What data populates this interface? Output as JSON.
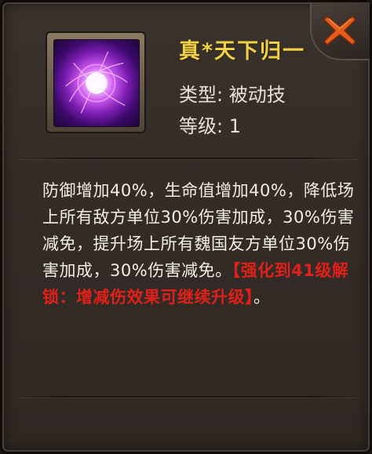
{
  "skill": {
    "name": "真*天下归一",
    "type_label": "类型:",
    "type_value": "被动技",
    "level_label": "等级:",
    "level_value": "1"
  },
  "description": {
    "main": "防御增加40%，生命值增加40%，降低场上所有敌方单位30%伤害加成，30%伤害减免，提升场上所有魏国友方单位30%伤害加成，30%伤害减免。",
    "unlock_note": "【强化到41级解锁：增减伤效果可继续升级】",
    "tail": "。"
  },
  "icons": {
    "close": "close-x-icon",
    "skill": "purple-energy-orb-icon"
  },
  "colors": {
    "title": "#f0d24a",
    "text": "#f3efe8",
    "highlight": "#e0201a",
    "close": "#e05a1a"
  }
}
